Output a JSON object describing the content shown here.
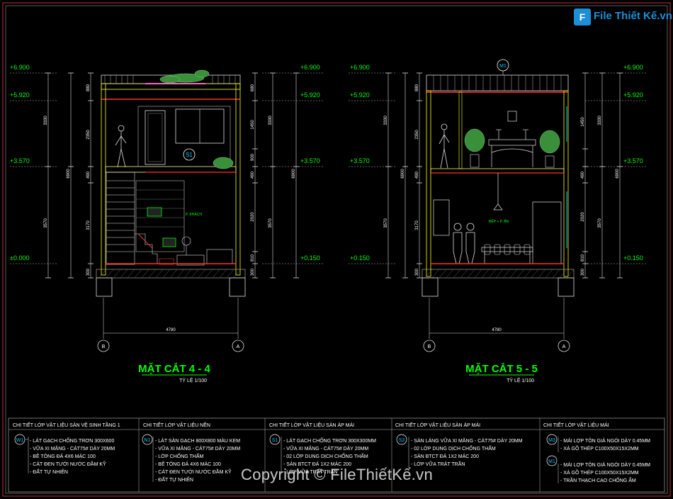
{
  "logo": {
    "icon": "F",
    "text": "File Thiết Kế.vn"
  },
  "watermark": "Copyright © FileThiếtKế.vn",
  "section_left": {
    "title": "MẶT CẮT 4 - 4",
    "scale": "TỶ LỆ  1/100",
    "levels_left": [
      "+6.900",
      "+5.920",
      "+3.570",
      "±0.000"
    ],
    "levels_right": [
      "+6.900",
      "+5.920",
      "+3.570",
      "+0.150"
    ],
    "dims_outer_left": [
      "3330",
      "6900",
      "3570"
    ],
    "dims_inner_left": [
      "880",
      "2350",
      "490",
      "3170",
      "300"
    ],
    "dims_outer_right": [
      "3330",
      "6900",
      "3570"
    ],
    "dims_inner_right": [
      "680",
      "1450",
      "900",
      "490",
      "2020",
      "810",
      "300"
    ],
    "width_dim": "4780",
    "axis_left": "B",
    "axis_right": "A",
    "tag": "S1",
    "room_label": "P. KHÁCH"
  },
  "section_right": {
    "title": "MẶT CẮT 5 - 5",
    "scale": "TỶ LỆ  1/100",
    "levels_left": [
      "+6.900",
      "+5.920",
      "+3.570",
      "+0.150"
    ],
    "levels_right": [
      "+6.900",
      "+5.920",
      "+3.570",
      "+0.150"
    ],
    "dims_outer_left": [
      "3330",
      "6900",
      "3570"
    ],
    "dims_inner_left": [
      "880",
      "2350",
      "490",
      "3170",
      "300"
    ],
    "dims_outer_right": [
      "3330",
      "6900",
      "3570"
    ],
    "dims_inner_right": [
      "1450",
      "490",
      "2020",
      "810",
      "300"
    ],
    "width_dim": "4780",
    "axis_left": "B",
    "axis_right": "A",
    "tag": "M1",
    "room_label": "BẾP + P. ĂN"
  },
  "legend": [
    {
      "title": "CHI TIẾT LỚP VẬT LIỆU SÀN VỆ SINH TẦNG 1",
      "tag": "W1",
      "lines": [
        "- LÁT GẠCH CHỐNG TRƠN 300X600",
        "- VỮA XI MĂNG - CÁT75# DÀY 20MM",
        "- BÊ TÔNG ĐÁ 4X6 MÁC 100",
        "- CÁT ĐEN TƯỚI NƯỚC ĐẦM KỸ",
        "- ĐẤT TỰ NHIÊN"
      ]
    },
    {
      "title": "CHI TIẾT LỚP VẬT LIỆU NỀN",
      "tag": "N1",
      "lines": [
        "- LÁT SÀN GẠCH 800X800 MÀU KEM",
        "- VỮA XI MĂNG - CÁT75# DÀY 20MM",
        "- LỚP CHỐNG THẤM",
        "- BÊ TÔNG ĐÁ 4X6 MÁC 100",
        "- CÁT ĐEN TƯỚI NƯỚC ĐẦM KỸ",
        "- ĐẤT TỰ NHIÊN"
      ]
    },
    {
      "title": "CHI TIẾT LỚP VẬT LIỆU SÀN ÁP MÁI",
      "tag": "S1",
      "lines": [
        "- LÁT GẠCH CHỐNG TRƠN 300X300MM",
        "- VỮA XI MĂNG - CÁT75# DÀY 20MM",
        "- 02 LỚP DUNG DỊCH CHỐNG THẤM",
        "- SÀN BTCT ĐÁ 1X2 MÁC 200",
        "- LỚP VỮA TRÁT TRẦN"
      ]
    },
    {
      "title": "CHI TIẾT LỚP VẬT LIỆU SÀN ÁP MÁI",
      "tag": "S3",
      "lines": [
        "- SÀN LÁNG VỮA XI MĂNG - CÁT75# DÀY 20MM",
        "- 02 LỚP DUNG DỊCH CHỐNG THẤM",
        "- SÀN BTCT ĐÁ 1X2 MÁC 200",
        "- LỚP VỮA TRÁT TRẦN"
      ]
    },
    {
      "title": "CHI TIẾT LỚP VẬT LIỆU MÁI",
      "tag": "M3",
      "tag2": "M1",
      "lines": [
        "- MÁI LỢP TÔN GIẢ NGÓI DÀY 0.45MM",
        "- XÀ GỒ THÉP C100X50X15X2MM"
      ],
      "lines2": [
        "- MÁI LỢP TÔN GIẢ NGÓI DÀY 0.45MM",
        "- XÀ GỒ THÉP C100X50X15X2MM",
        "- TRẦN THẠCH CAO CHỐNG ẨM"
      ]
    }
  ],
  "colors": {
    "background": "#000000",
    "text": "#ffffff",
    "green": "#00ff00",
    "yellow": "#ffff00",
    "red": "#ff2020",
    "magenta": "#ff00ff",
    "cyan": "#00c8ff"
  }
}
